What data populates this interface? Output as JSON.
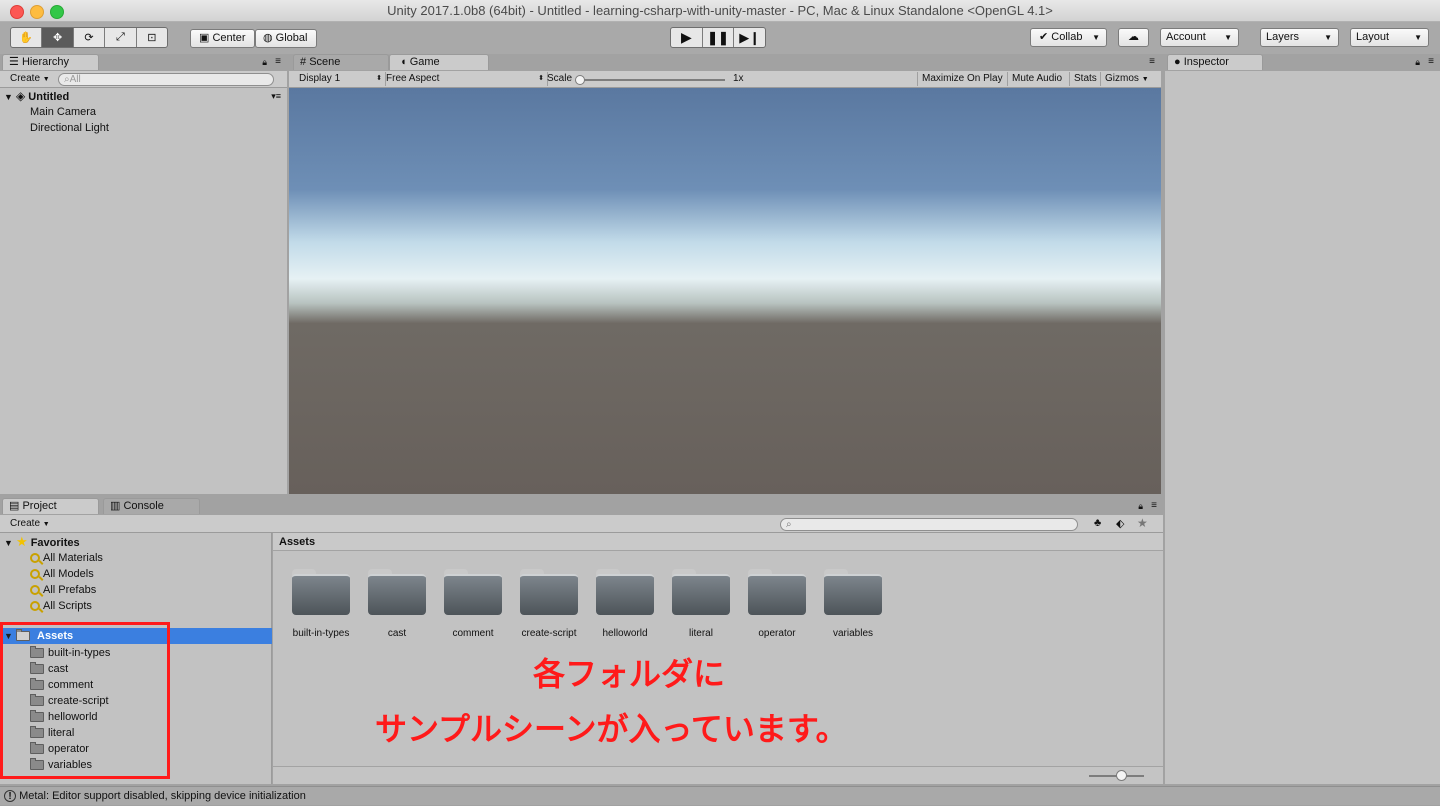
{
  "window": {
    "title": "Unity 2017.1.0b8 (64bit) - Untitled - learning-csharp-with-unity-master - PC, Mac & Linux Standalone <OpenGL 4.1>"
  },
  "toolbar": {
    "pivot_center": "Center",
    "pivot_global": "Global",
    "collab": "Collab",
    "account": "Account",
    "layers": "Layers",
    "layout": "Layout"
  },
  "hierarchy": {
    "tab": "Hierarchy",
    "create": "Create",
    "search_placeholder": "All",
    "scene": "Untitled",
    "items": [
      "Main Camera",
      "Directional Light"
    ]
  },
  "scene_tab": "Scene",
  "game": {
    "tab": "Game",
    "display": "Display 1",
    "aspect": "Free Aspect",
    "scale_label": "Scale",
    "scale_value": "1x",
    "maximize": "Maximize On Play",
    "mute": "Mute Audio",
    "stats": "Stats",
    "gizmos": "Gizmos"
  },
  "inspector": {
    "tab": "Inspector"
  },
  "project": {
    "tab": "Project",
    "console_tab": "Console",
    "create": "Create",
    "favorites_label": "Favorites",
    "favorites": [
      "All Materials",
      "All Models",
      "All Prefabs",
      "All Scripts"
    ],
    "assets_label": "Assets",
    "folders": [
      "built-in-types",
      "cast",
      "comment",
      "create-script",
      "helloworld",
      "literal",
      "operator",
      "variables"
    ],
    "breadcrumb": "Assets"
  },
  "annotation": {
    "line1": "各フォルダに",
    "line2": "サンプルシーンが入っています。",
    "color": "#ff1a1a"
  },
  "statusbar": {
    "message": "Metal: Editor support disabled, skipping device initialization"
  }
}
